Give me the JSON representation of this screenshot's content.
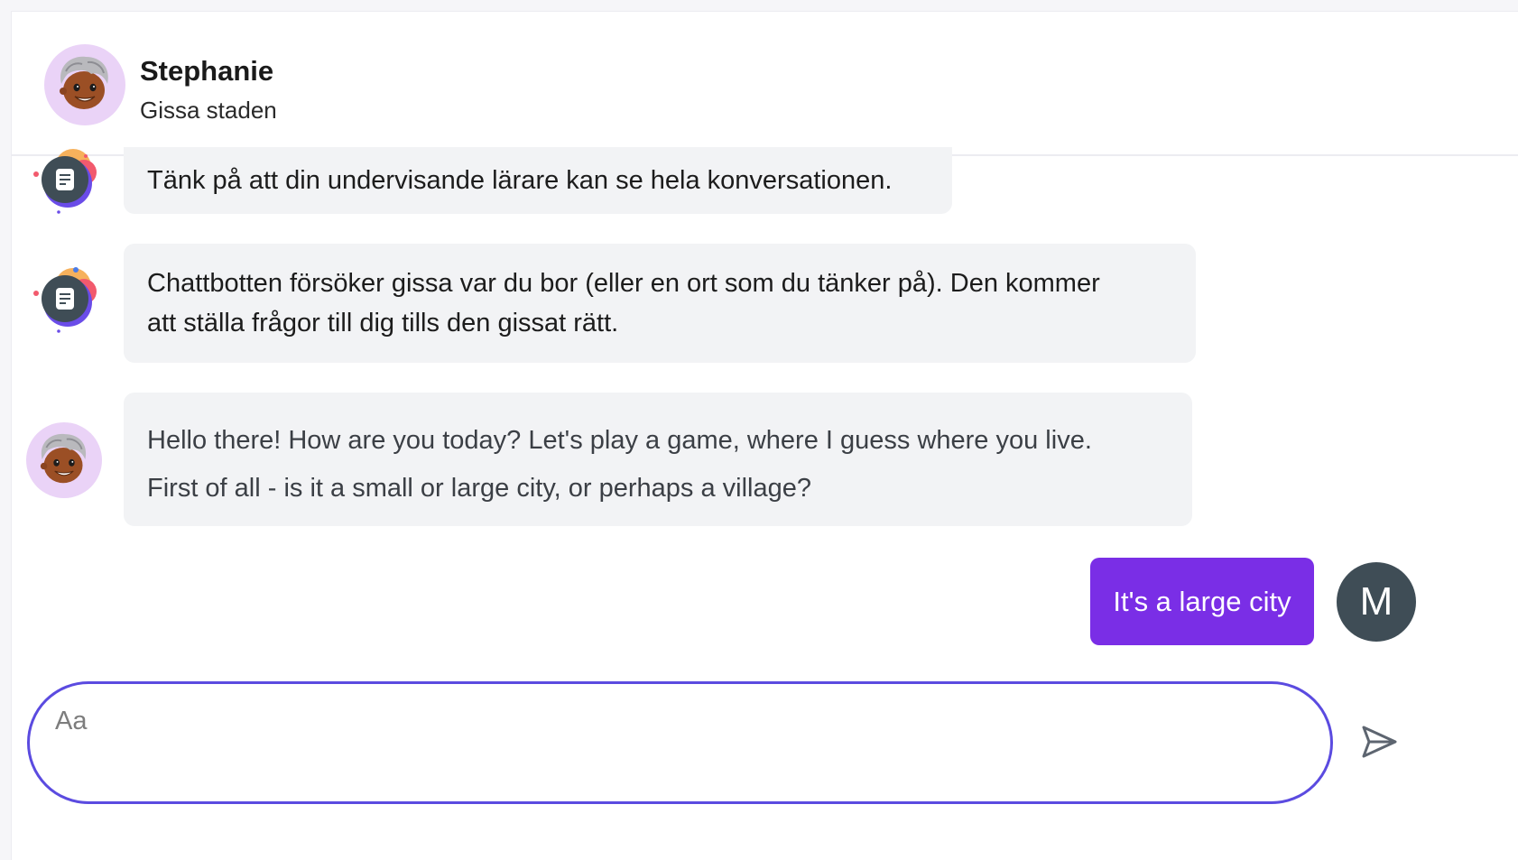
{
  "header": {
    "name": "Stephanie",
    "subtitle": "Gissa staden",
    "avatar_icon": "cartoon-person-avatar-icon"
  },
  "messages": [
    {
      "role": "system",
      "avatar_icon": "document-avatar-icon",
      "text": "Tänk på att din undervisande lärare kan se hela konversationen."
    },
    {
      "role": "system",
      "avatar_icon": "document-avatar-icon",
      "lines": [
        "Chattbotten försöker gissa var du bor (eller en ort som du tänker på). Den kommer",
        "att ställa frågor till dig tills den gissat rätt."
      ]
    },
    {
      "role": "bot",
      "avatar_icon": "cartoon-person-avatar-icon",
      "lines": [
        "Hello there! How are you today? Let's play a game, where I guess where you live.",
        "First of all - is it a small or large city, or perhaps a village?"
      ]
    },
    {
      "role": "user",
      "text": "It's a large city",
      "avatar_initial": "M"
    }
  ],
  "composer": {
    "placeholder": "Aa",
    "value": "",
    "send_icon": "send-icon"
  },
  "colors": {
    "accent": "#7a2ee6",
    "input_border": "#5b4be0",
    "bubble_bg": "#f2f3f5",
    "avatar_bg": "#ead3f7",
    "user_avatar_bg": "#3f4d56"
  }
}
